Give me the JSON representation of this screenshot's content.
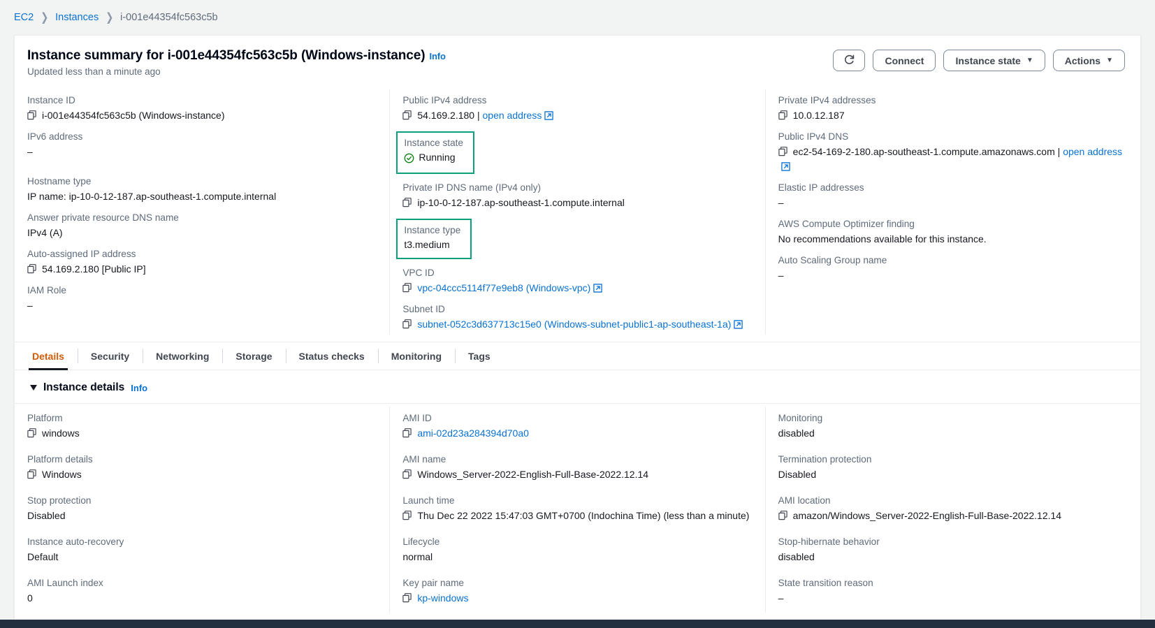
{
  "breadcrumb": {
    "items": [
      {
        "label": "EC2",
        "type": "link"
      },
      {
        "label": "Instances",
        "type": "link"
      },
      {
        "label": "i-001e44354fc563c5b",
        "type": "current"
      }
    ],
    "separator": "❯"
  },
  "header": {
    "title": "Instance summary for i-001e44354fc563c5b (Windows-instance)",
    "info_label": "Info",
    "updated": "Updated less than a minute ago",
    "refresh_icon": "refresh-icon",
    "connect_label": "Connect",
    "instance_state_label": "Instance state",
    "actions_label": "Actions",
    "caret": "▼"
  },
  "summary": {
    "col1": [
      {
        "label": "Instance ID",
        "value": "i-001e44354fc563c5b (Windows-instance)",
        "copy": true,
        "link": false
      },
      {
        "label": "IPv6 address",
        "value": "–",
        "copy": false,
        "link": false,
        "tall": true
      },
      {
        "label": "Hostname type",
        "value": "IP name: ip-10-0-12-187.ap-southeast-1.compute.internal",
        "copy": false,
        "link": false
      },
      {
        "label": "Answer private resource DNS name",
        "value": "IPv4 (A)",
        "copy": false,
        "link": false
      },
      {
        "label": "Auto-assigned IP address",
        "value": "54.169.2.180 [Public IP]",
        "copy": true,
        "link": false
      },
      {
        "label": "IAM Role",
        "value": "–",
        "copy": false,
        "link": false
      }
    ],
    "col2": [
      {
        "label": "Public IPv4 address",
        "value": "54.169.2.180",
        "copy": true,
        "link": false,
        "suffix_sep": " | ",
        "suffix_link": "open address",
        "external": true
      },
      {
        "label": "Instance state",
        "value": "Running",
        "highlight": true,
        "status": "running"
      },
      {
        "label": "Private IP DNS name (IPv4 only)",
        "value": "ip-10-0-12-187.ap-southeast-1.compute.internal",
        "copy": true,
        "link": false
      },
      {
        "label": "Instance type",
        "value": "t3.medium",
        "highlight": true
      },
      {
        "label": "VPC ID",
        "value": "vpc-04ccc5114f77e9eb8 (Windows-vpc)",
        "copy": true,
        "link": true,
        "external": true
      },
      {
        "label": "Subnet ID",
        "value": "subnet-052c3d637713c15e0 (Windows-subnet-public1-ap-southeast-1a)",
        "copy": true,
        "link": true,
        "external": true
      }
    ],
    "col3": [
      {
        "label": "Private IPv4 addresses",
        "value": "10.0.12.187",
        "copy": true,
        "link": false
      },
      {
        "label": "Public IPv4 DNS",
        "value": "ec2-54-169-2-180.ap-southeast-1.compute.amazonaws.com",
        "copy": true,
        "link": false,
        "suffix_sep": " | ",
        "suffix_link": "open address",
        "external": true,
        "tall": true
      },
      {
        "label": "Elastic IP addresses",
        "value": "–",
        "copy": false,
        "link": false
      },
      {
        "label": "AWS Compute Optimizer finding",
        "value": "No recommendations available for this instance.",
        "copy": false,
        "link": false
      },
      {
        "label": "Auto Scaling Group name",
        "value": "–",
        "copy": false,
        "link": false
      }
    ]
  },
  "tabs": [
    {
      "label": "Details",
      "active": true
    },
    {
      "label": "Security",
      "active": false
    },
    {
      "label": "Networking",
      "active": false
    },
    {
      "label": "Storage",
      "active": false
    },
    {
      "label": "Status checks",
      "active": false
    },
    {
      "label": "Monitoring",
      "active": false
    },
    {
      "label": "Tags",
      "active": false
    }
  ],
  "instance_details": {
    "title": "Instance details",
    "info_label": "Info",
    "col1": [
      {
        "label": "Platform",
        "value": "windows",
        "copy": true
      },
      {
        "label": "Platform details",
        "value": "Windows",
        "copy": true
      },
      {
        "label": "Stop protection",
        "value": "Disabled",
        "copy": false
      },
      {
        "label": "Instance auto-recovery",
        "value": "Default",
        "copy": false
      },
      {
        "label": "AMI Launch index",
        "value": "0",
        "copy": false
      }
    ],
    "col2": [
      {
        "label": "AMI ID",
        "value": "ami-02d23a284394d70a0",
        "copy": true,
        "link": true
      },
      {
        "label": "AMI name",
        "value": "Windows_Server-2022-English-Full-Base-2022.12.14",
        "copy": true
      },
      {
        "label": "Launch time",
        "value": "Thu Dec 22 2022 15:47:03 GMT+0700 (Indochina Time) (less than a minute)",
        "copy": true
      },
      {
        "label": "Lifecycle",
        "value": "normal",
        "copy": false
      },
      {
        "label": "Key pair name",
        "value": "kp-windows",
        "copy": true,
        "link": true
      }
    ],
    "col3": [
      {
        "label": "Monitoring",
        "value": "disabled",
        "copy": false
      },
      {
        "label": "Termination protection",
        "value": "Disabled",
        "copy": false
      },
      {
        "label": "AMI location",
        "value": "amazon/Windows_Server-2022-English-Full-Base-2022.12.14",
        "copy": true
      },
      {
        "label": "Stop-hibernate behavior",
        "value": "disabled",
        "copy": false
      },
      {
        "label": "State transition reason",
        "value": "–",
        "copy": false
      }
    ]
  },
  "colors": {
    "link": "#0972d3",
    "highlight_border": "#0c9f7c",
    "status_running": "#037f0c",
    "tab_active": "#d45b07",
    "label": "#5f6b7a"
  }
}
